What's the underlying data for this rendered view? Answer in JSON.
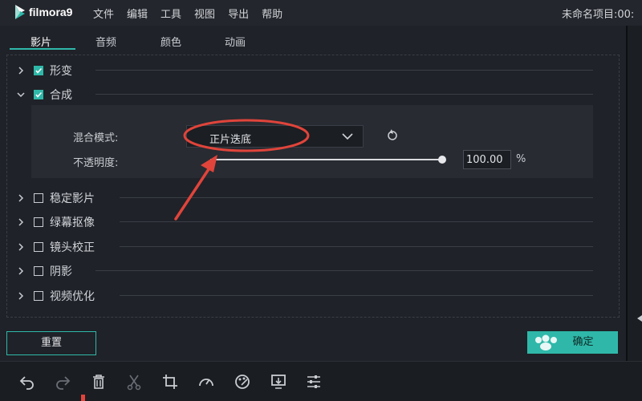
{
  "app": {
    "logo_text": "filmora9",
    "project_title": "未命名项目:00:"
  },
  "menu": [
    "文件",
    "编辑",
    "工具",
    "视图",
    "导出",
    "帮助"
  ],
  "tabs": [
    "影片",
    "音频",
    "颜色",
    "动画"
  ],
  "active_tab": "影片",
  "sections": {
    "transform": {
      "label": "形变",
      "checked": true,
      "expanded": false
    },
    "composite": {
      "label": "合成",
      "checked": true,
      "expanded": true
    },
    "stabilize": {
      "label": "稳定影片",
      "checked": false
    },
    "chroma": {
      "label": "绿幕抠像",
      "checked": false
    },
    "lens": {
      "label": "镜头校正",
      "checked": false
    },
    "shadow": {
      "label": "阴影",
      "checked": false
    },
    "enhance": {
      "label": "视频优化",
      "checked": false
    }
  },
  "composite": {
    "blend_label": "混合模式:",
    "blend_value": "正片迭底",
    "opacity_label": "不透明度:",
    "opacity_value": "100.00",
    "opacity_fraction": 1.0,
    "opacity_unit": "%"
  },
  "buttons": {
    "reset": "重置",
    "ok": "确定"
  },
  "colors": {
    "accent": "#2fb8a9",
    "annotation": "#e0443b"
  },
  "icons": {
    "toolbar": [
      "undo-icon",
      "redo-icon",
      "delete-icon",
      "scissors-icon",
      "crop-icon",
      "speed-icon",
      "color-icon",
      "export-frame-icon",
      "adjust-icon"
    ]
  }
}
